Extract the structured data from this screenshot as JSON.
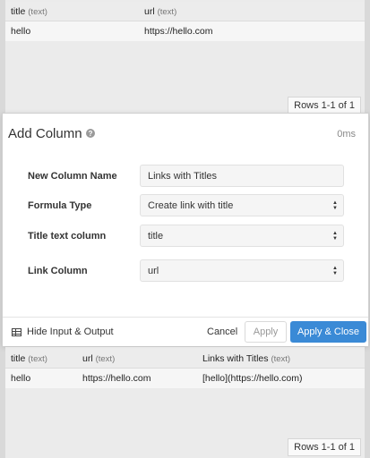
{
  "input_table": {
    "columns": [
      {
        "name": "title",
        "type": "(text)"
      },
      {
        "name": "url",
        "type": "(text)"
      }
    ],
    "rows": [
      [
        "hello",
        "https://hello.com"
      ]
    ],
    "rows_label": "Rows 1-1 of 1"
  },
  "modal": {
    "title": "Add Column",
    "help_icon": "?",
    "elapsed": "0ms",
    "fields": {
      "new_column_name": {
        "label": "New Column Name",
        "value": "Links with Titles"
      },
      "formula_type": {
        "label": "Formula Type",
        "value": "Create link with title"
      },
      "title_text_column": {
        "label": "Title text column",
        "value": "title"
      },
      "link_column": {
        "label": "Link Column",
        "value": "url"
      }
    },
    "footer": {
      "hide_io_label": "Hide Input & Output",
      "cancel_label": "Cancel",
      "apply_label": "Apply",
      "apply_close_label": "Apply & Close"
    }
  },
  "output_table": {
    "columns": [
      {
        "name": "title",
        "type": "(text)"
      },
      {
        "name": "url",
        "type": "(text)"
      },
      {
        "name": "Links with Titles",
        "type": "(text)"
      }
    ],
    "rows": [
      [
        "hello",
        "https://hello.com",
        "[hello](https://hello.com)"
      ]
    ],
    "rows_label": "Rows 1-1 of 1"
  },
  "colors": {
    "accent": "#3a8ad6",
    "background": "#d9d9d9",
    "table_bg": "#ebebeb"
  }
}
